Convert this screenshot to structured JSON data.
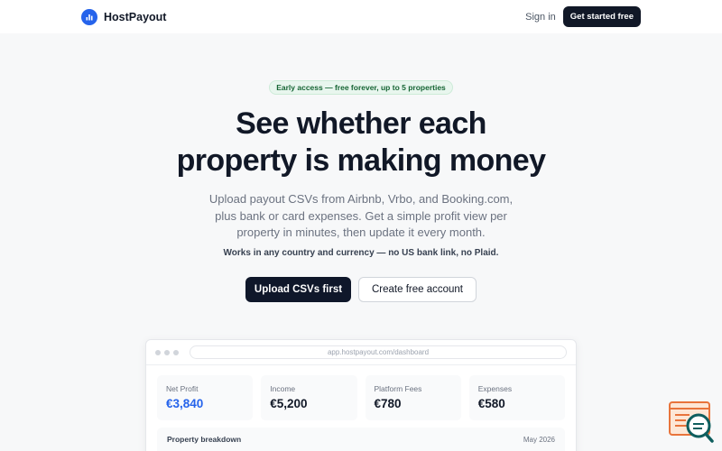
{
  "nav": {
    "brand": "HostPayout",
    "sign_in": "Sign in",
    "get_started": "Get started free"
  },
  "hero": {
    "badge": "Early access — free forever, up to 5 properties",
    "title_line1": "See whether each",
    "title_line2": "property is making money",
    "sub_line1": "Upload payout CSVs from Airbnb, Vrbo, and Booking.com,",
    "sub_line2": "plus bank or card expenses. Get a simple profit view per",
    "sub_line3": "property in minutes, then update it every month.",
    "note": "Works in any country and currency — no US bank link, no Plaid.",
    "cta_primary": "Upload CSVs first",
    "cta_secondary": "Create free account"
  },
  "preview": {
    "url": "app.hostpayout.com/dashboard",
    "stats": [
      {
        "label": "Net Profit",
        "value": "€3,840"
      },
      {
        "label": "Income",
        "value": "€5,200"
      },
      {
        "label": "Platform Fees",
        "value": "€780"
      },
      {
        "label": "Expenses",
        "value": "€580"
      }
    ],
    "breakdown_title": "Property breakdown",
    "breakdown_date": "May 2026"
  },
  "colors": {
    "accent": "#2563eb",
    "dark": "#111827",
    "badge_bg": "#e8f6ee",
    "badge_text": "#166534",
    "widget_orange": "#e8743b",
    "widget_teal": "#0f5e5e"
  },
  "icons": {
    "brand": "bar-chart-icon",
    "chat_widget": "chat-support-icon"
  }
}
